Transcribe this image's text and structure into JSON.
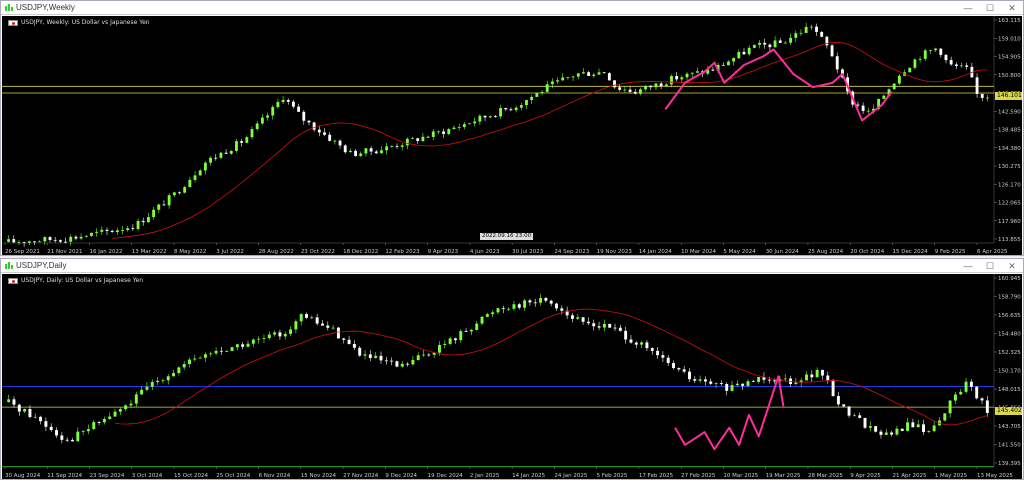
{
  "windows": [
    {
      "id": "weekly",
      "title": "USDJPY,Weekly",
      "symbol_label": "USDJPY, Weekly:  US Dollar vs Japanese Yen",
      "price_ticks": [
        "163.115",
        "159.010",
        "154.905",
        "150.800",
        "146.695",
        "142.590",
        "138.485",
        "134.380",
        "130.275",
        "126.170",
        "122.065",
        "117.960",
        "113.855"
      ],
      "current_price": "146.101",
      "date_ticks": [
        "26 Sep 2021",
        "21 Nov 2021",
        "16 Jan 2022",
        "13 Mar 2022",
        "8 May 2022",
        "3 Jul 2022",
        "28 Aug 2022",
        "23 Oct 2022",
        "18 Dec 2022",
        "12 Feb 2023",
        "9 Apr 2023",
        "4 Jun 2023",
        "30 Jul 2023",
        "24 Sep 2023",
        "19 Nov 2023",
        "14 Jan 2024",
        "10 Mar 2024",
        "5 May 2024",
        "30 Jun 2024",
        "25 Aug 2024",
        "20 Oct 2024",
        "15 Dec 2024",
        "9 Feb 2025",
        "6 Apr 2025"
      ],
      "time_box": [
        "2022.09.16",
        "23:00"
      ]
    },
    {
      "id": "daily",
      "title": "USDJPY,Daily",
      "symbol_label": "USDJPY, Daily:  US Dollar vs Japanese Yen",
      "price_ticks": [
        "160.945",
        "158.790",
        "156.635",
        "154.480",
        "152.325",
        "150.170",
        "148.015",
        "145.860",
        "143.705",
        "141.550",
        "139.395"
      ],
      "current_price": "145.402",
      "date_ticks": [
        "30 Aug 2024",
        "11 Sep 2024",
        "23 Sep 2024",
        "3 Oct 2024",
        "15 Oct 2024",
        "25 Oct 2024",
        "6 Nov 2024",
        "15 Nov 2024",
        "27 Nov 2024",
        "9 Dec 2024",
        "19 Dec 2024",
        "2 Jan 2025",
        "14 Jan 2025",
        "24 Jan 2025",
        "5 Feb 2025",
        "17 Feb 2025",
        "27 Feb 2025",
        "10 Mar 2025",
        "19 Mar 2025",
        "28 Mar 2025",
        "9 Apr 2025",
        "21 Apr 2025",
        "1 May 2025",
        "13 May 2025"
      ]
    }
  ],
  "window_buttons": {
    "minimize": "—",
    "maximize": "☐",
    "close": "✕"
  },
  "colors": {
    "background": "#000000",
    "bull_candle": "#7cff3c",
    "bear_candle": "#ffffff",
    "moving_average": "#d01010",
    "level_line_yellow": "#d8d84a",
    "level_line_blue": "#2040ff",
    "pattern": "#ff2d9a",
    "bottom_line": "#22aa22"
  },
  "icons": {
    "title_icon": "chart-window-icon"
  }
}
